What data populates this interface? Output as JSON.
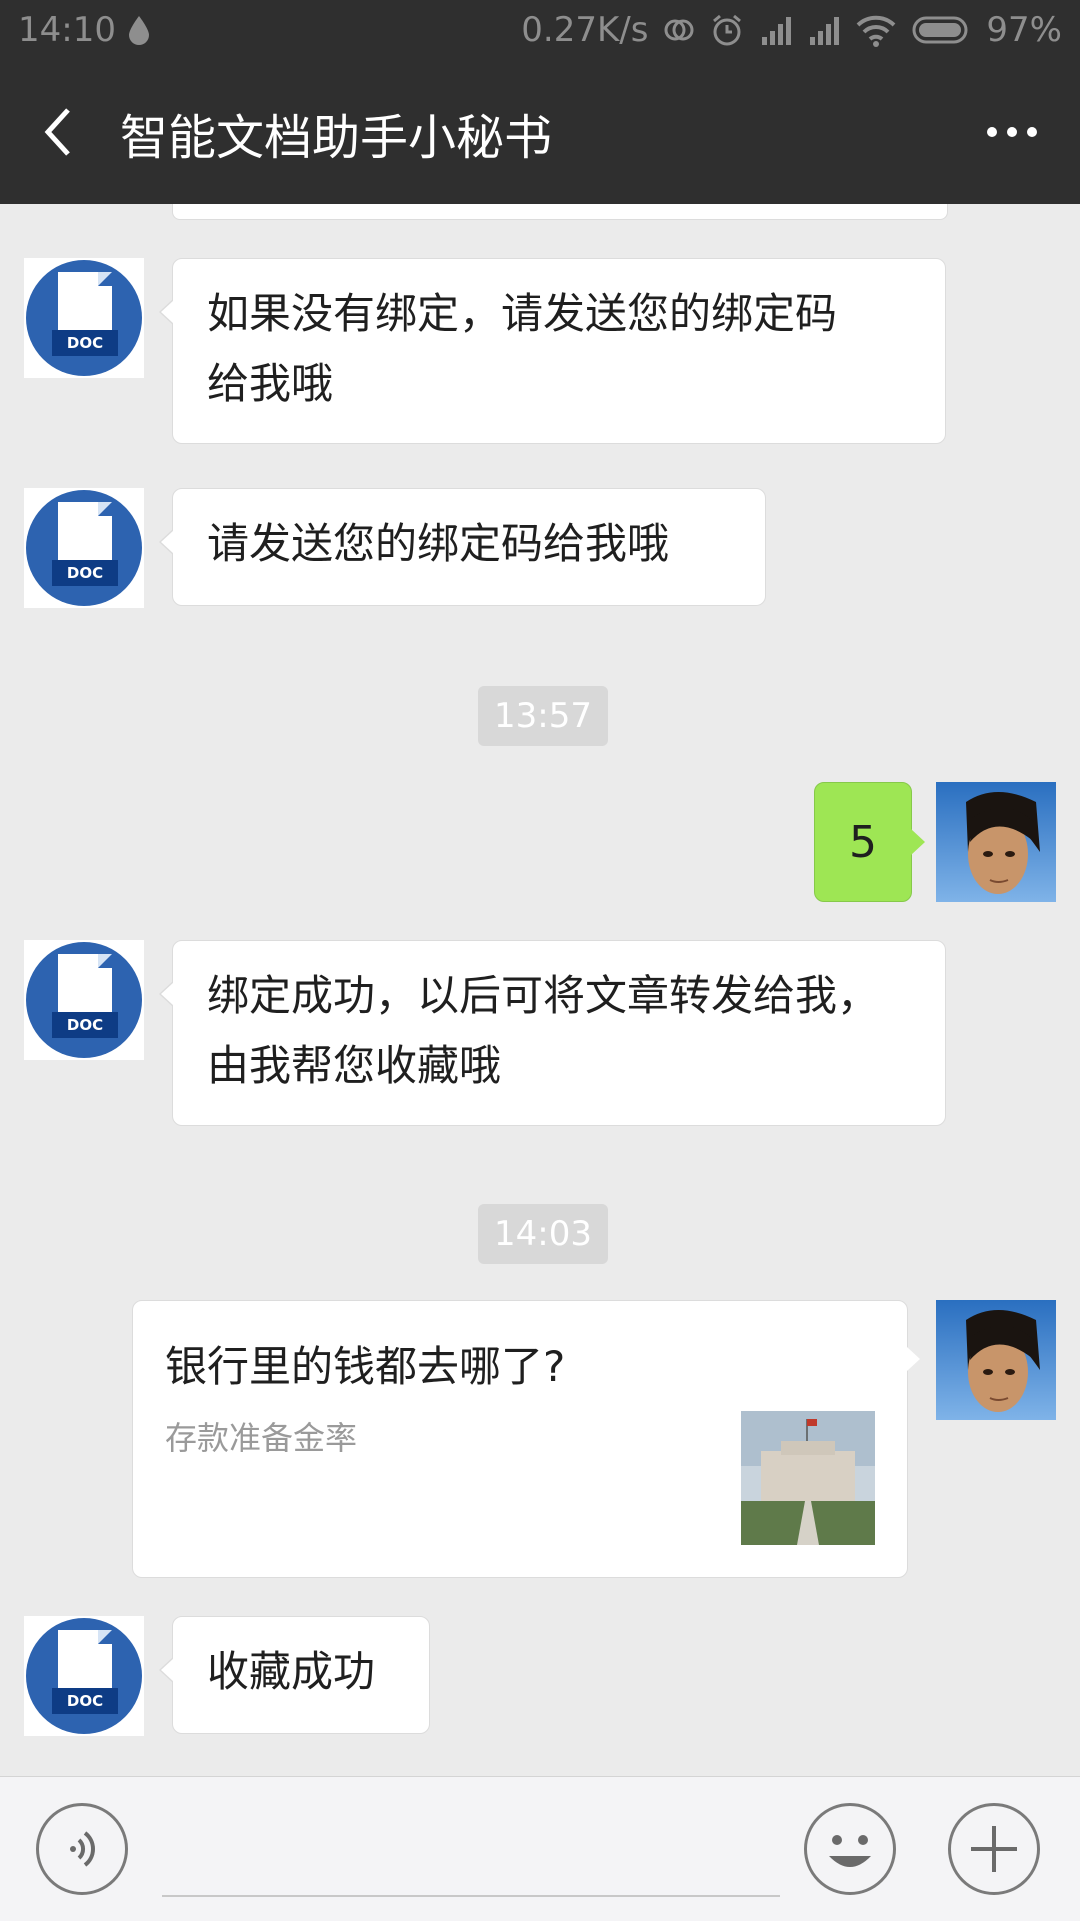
{
  "status_bar": {
    "time": "14:10",
    "network_speed": "0.27K/s",
    "battery": "97%"
  },
  "header": {
    "title": "智能文档助手小秘书",
    "back_icon": "chevron-left-icon",
    "more_icon": "more-dots-icon"
  },
  "messages": [
    {
      "from": "bot",
      "text_line1": "如果没有绑定，请发送您的绑定码",
      "text_line2": "给我哦"
    },
    {
      "from": "bot",
      "text": "请发送您的绑定码给我哦"
    },
    {
      "timestamp": "13:57"
    },
    {
      "from": "user",
      "text": "5"
    },
    {
      "from": "bot",
      "text_line1": "绑定成功，以后可将文章转发给我，",
      "text_line2": "由我帮您收藏哦"
    },
    {
      "timestamp": "14:03"
    },
    {
      "from": "user",
      "type": "link",
      "title": "银行里的钱都去哪了?",
      "description": "存款准备金率"
    },
    {
      "from": "bot",
      "text": "收藏成功"
    }
  ],
  "doc_avatar_label": "DOC",
  "input_bar": {
    "voice_icon": "voice-icon",
    "emoji_icon": "emoji-icon",
    "plus_icon": "plus-icon"
  },
  "colors": {
    "header_bg": "#2f2f2f",
    "chat_bg": "#ebebeb",
    "user_bubble": "#9ee654",
    "doc_blue": "#2d63b0"
  }
}
